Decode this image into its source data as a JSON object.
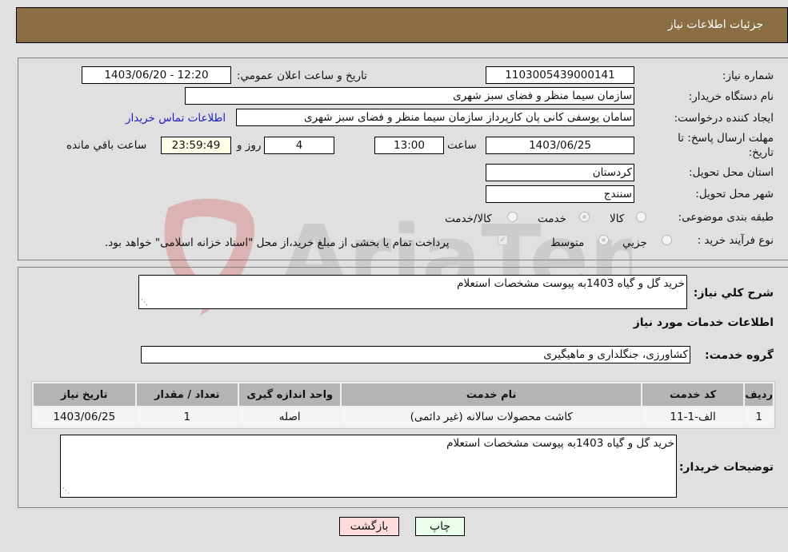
{
  "header": {
    "title": "جزئیات اطلاعات نیاز"
  },
  "form": {
    "need_number": {
      "label": "شماره نیاز:",
      "value": "1103005439000141"
    },
    "announce_datetime": {
      "label": "تاریخ و ساعت اعلان عمومي:",
      "value": "1403/06/20 - 12:20"
    },
    "buyer_org": {
      "label": "نام دستگاه خریدار:",
      "value": "سازمان سیما  منظر و فضای سبز شهری"
    },
    "creator": {
      "label": "ایجاد کننده درخواست:",
      "value": "سامان یوسفی کانی پان کارپرداز سازمان سیما  منظر و فضای سبز شهری"
    },
    "contact_link": "اطلاعات تماس خریدار",
    "deadline": {
      "label_line1": "مهلت ارسال پاسخ: تا",
      "label_line2": "تاریخ:",
      "date": "1403/06/25",
      "time_label": "ساعت",
      "time": "13:00",
      "days": "4",
      "days_label": "روز و",
      "countdown": "23:59:49",
      "remaining_label": "ساعت باقي مانده"
    },
    "province": {
      "label": "استان محل تحویل:",
      "value": "کردستان"
    },
    "city": {
      "label": "شهر محل تحویل:",
      "value": "سنندج"
    },
    "category": {
      "label": "طبقه بندی موضوعی:",
      "options": [
        "کالا",
        "خدمت",
        "کالا/خدمت"
      ],
      "selected": "خدمت"
    },
    "purchase_process": {
      "label": "نوع فرآیند خرید :",
      "options": [
        "جزیي",
        "متوسط"
      ],
      "selected": "متوسط",
      "payment_note": "پرداخت تمام یا بخشی از مبلغ خرید،از محل \"اسناد خزانه اسلامی\" خواهد بود.",
      "payment_checked": true
    }
  },
  "details": {
    "summary_label": "شرح کلي نیاز:",
    "summary_value": "خرید گل و گیاه 1403به پیوست مشخصات استعلام",
    "services_heading": "اطلاعات خدمات مورد نیاز",
    "service_group_label": "گروه خدمت:",
    "service_group_value": "کشاورزی، جنگلداری و ماهیگیری",
    "table": {
      "headers": [
        "ردیف",
        "کد خدمت",
        "نام خدمت",
        "واحد اندازه گیری",
        "تعداد / مقدار",
        "تاریخ نیاز"
      ],
      "rows": [
        [
          "1",
          "الف-1-11",
          "کاشت محصولات سالانه (غیر دائمی)",
          "اصله",
          "1",
          "1403/06/25"
        ]
      ]
    },
    "buyer_notes_label": "توضیحات خریدار:",
    "buyer_notes_value": "خرید گل و گیاه 1403به پیوست مشخصات استعلام"
  },
  "buttons": {
    "print": "چاپ",
    "back": "بازگشت"
  },
  "watermark": "AriaTender.neT"
}
